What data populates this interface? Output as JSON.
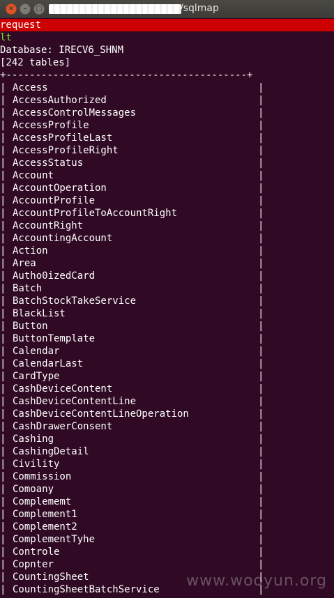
{
  "window": {
    "title": "/sqlmap"
  },
  "terminal": {
    "command_line": "request",
    "line2": "lt",
    "database_line": "Database: IRECV6_SHNM",
    "tables_count": "[242 tables]",
    "border": "+-----------------------------------------+",
    "tables": [
      "Access",
      "AccessAuthorized",
      "AccessControlMessages",
      "AccessProfile",
      "AccessProfileLast",
      "AccessProfileRight",
      "AccessStatus",
      "Account",
      "AccountOperation",
      "AccountProfile",
      "AccountProfileToAccountRight",
      "AccountRight",
      "AccountingAccount",
      "Action",
      "Area",
      "Autho0izedCard",
      "Batch",
      "BatchStockTakeService",
      "BlackList",
      "Button",
      "ButtonTemplate",
      "Calendar",
      "CalendarLast",
      "CardType",
      "CashDeviceContent",
      "CashDeviceContentLine",
      "CashDeviceContentLineOperation",
      "CashDrawerConsent",
      "Cashing",
      "CashingDetail",
      "Civility",
      "Commission",
      "Comoany",
      "Complememt",
      "Complement1",
      "Complement2",
      "ComplementTyhe",
      "Controle",
      "Copnter",
      "CountingSheet",
      "CountingSheetBatchService"
    ]
  },
  "watermark": "www.wooyun.org",
  "colors": {
    "background": "#300a24",
    "command_highlight": "#cc0000",
    "green_text": "#8ae234"
  }
}
